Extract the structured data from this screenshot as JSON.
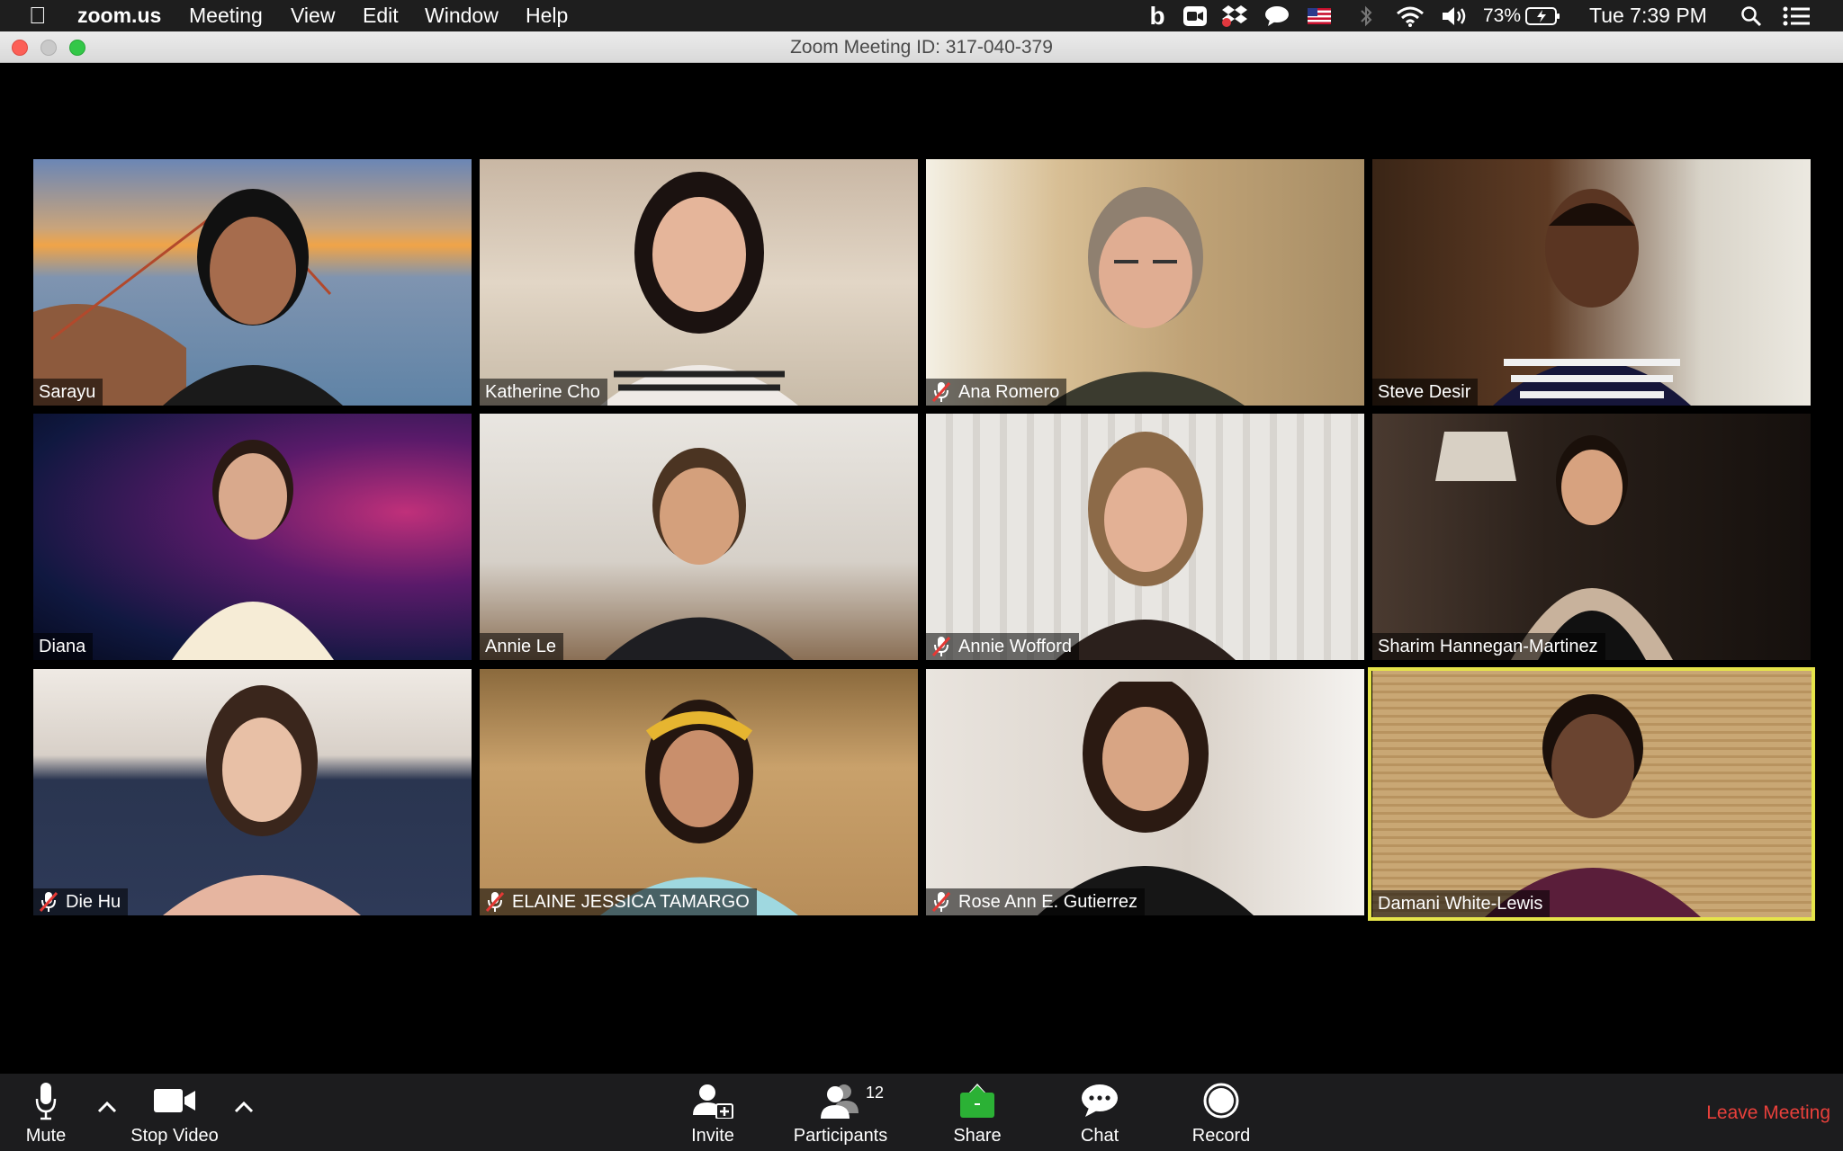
{
  "menubar": {
    "apple_icon": "apple-logo-icon",
    "app_name": "zoom.us",
    "items": [
      "Meeting",
      "View",
      "Edit",
      "Window",
      "Help"
    ],
    "tray_icons": [
      "bold-b-icon",
      "zoom-icon",
      "dropbox-icon",
      "chat-bubble-icon",
      "us-flag-icon",
      "bluetooth-icon",
      "wifi-icon",
      "volume-icon"
    ],
    "battery_percent": "73%",
    "battery_icon": "battery-charging-icon",
    "clock": "Tue 7:39 PM",
    "search_icon": "spotlight-search-icon",
    "list_icon": "notification-center-icon"
  },
  "window": {
    "title": "Zoom Meeting ID: 317-040-379",
    "traffic_lights": {
      "close": "#fc5f57",
      "minimize": "#b9b9b9",
      "zoom": "#33c748"
    }
  },
  "participants": [
    {
      "name": "Sarayu",
      "muted": false
    },
    {
      "name": "Katherine Cho",
      "muted": false
    },
    {
      "name": "Ana Romero",
      "muted": true
    },
    {
      "name": "Steve Desir",
      "muted": false
    },
    {
      "name": "Diana",
      "muted": false
    },
    {
      "name": "Annie Le",
      "muted": false
    },
    {
      "name": "Annie Wofford",
      "muted": true
    },
    {
      "name": "Sharim Hannegan-Martinez",
      "muted": false
    },
    {
      "name": "Die Hu",
      "muted": true
    },
    {
      "name": "ELAINE JESSICA TAMARGO",
      "muted": true
    },
    {
      "name": "Rose Ann E. Gutierrez",
      "muted": true
    },
    {
      "name": "Damani White-Lewis",
      "muted": false,
      "active_speaker": true
    }
  ],
  "toolbar": {
    "mute_label": "Mute",
    "stop_video_label": "Stop Video",
    "invite_label": "Invite",
    "participants_label": "Participants",
    "participants_count": "12",
    "share_label": "Share",
    "chat_label": "Chat",
    "record_label": "Record",
    "leave_label": "Leave Meeting"
  },
  "colors": {
    "active_speaker_border": "#e6e44a",
    "leave_meeting": "#e8403b",
    "share_green": "#2bb135",
    "background": "#000000",
    "toolbar_bg": "#1c1c1e"
  }
}
